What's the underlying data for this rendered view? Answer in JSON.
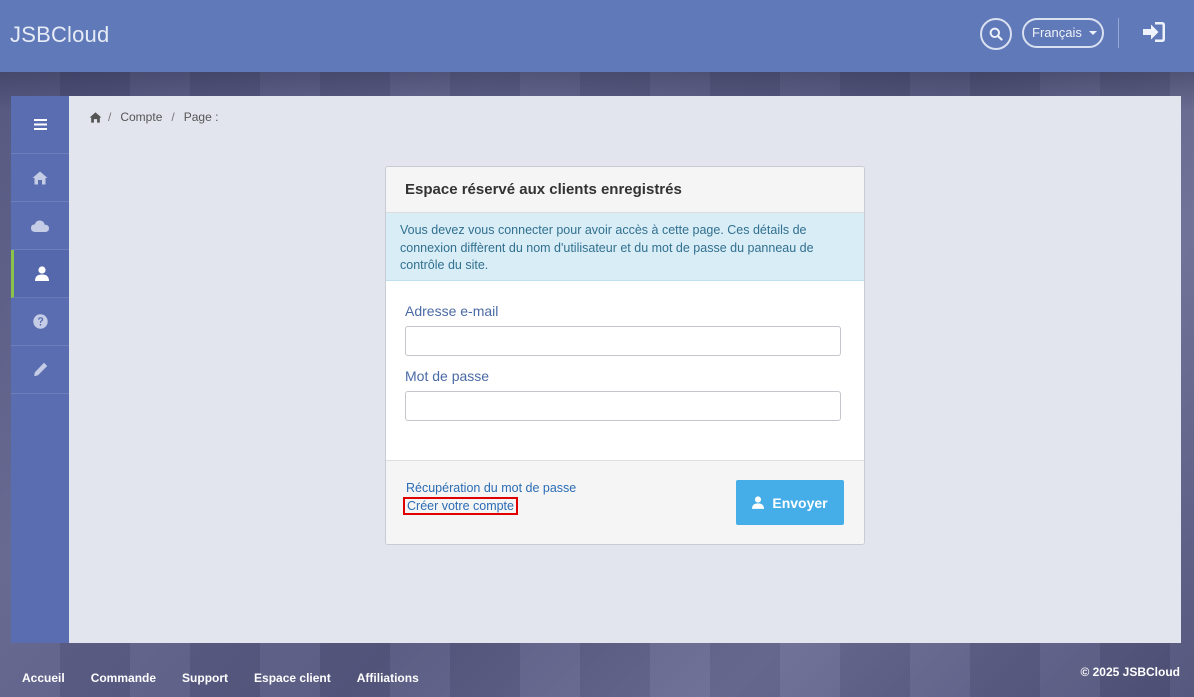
{
  "header": {
    "logo": "JSBCloud",
    "language": "Français",
    "icons": [
      "search-icon",
      "chevron-down-icon",
      "sign-in-icon"
    ]
  },
  "sidebar": {
    "items": [
      {
        "icon": "menu-icon"
      },
      {
        "icon": "home-icon"
      },
      {
        "icon": "cloud-icon"
      },
      {
        "icon": "user-icon",
        "active": true
      },
      {
        "icon": "question-icon"
      },
      {
        "icon": "pencil-icon"
      }
    ],
    "active_color": "#8bc34a"
  },
  "breadcrumb": {
    "icon": "home-icon",
    "items": [
      "Compte",
      "Page :"
    ]
  },
  "login_card": {
    "title": "Espace réservé aux clients enregistrés",
    "info": "Vous devez vous connecter pour avoir accès à cette page. Ces détails de connexion diffèrent du nom d'utilisateur et du mot de passe du panneau de contrôle du site.",
    "email_label": "Adresse e-mail",
    "email_value": "",
    "password_label": "Mot de passe",
    "password_value": "",
    "forgot_link": "Récupération du mot de passe",
    "create_link": "Créer votre compte",
    "submit_label": "Envoyer"
  },
  "footer": {
    "links": [
      "Accueil",
      "Commande",
      "Support",
      "Espace client",
      "Affiliations"
    ],
    "copyright": "© 2025 JSBCloud"
  },
  "colors": {
    "header_bg": "#6079b8",
    "sidebar_bg": "#5b6db1",
    "info_bg": "#d9edf7",
    "button_bg": "#45aee8",
    "highlight": "#e00000"
  }
}
